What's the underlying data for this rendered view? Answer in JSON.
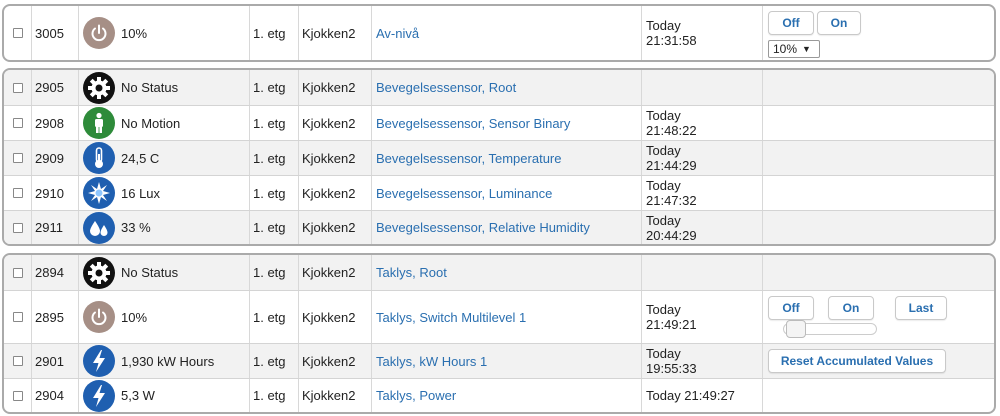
{
  "groups": [
    {
      "rows": [
        {
          "id": "3005",
          "icon": "power-icon",
          "icon_color": "#a68f86",
          "status": "10%",
          "floor": "1. etg",
          "room": "Kjokken2",
          "name": "Av-nivå",
          "time1": "Today",
          "time2": "21:31:58",
          "controls": {
            "off_label": "Off",
            "on_label": "On",
            "select_value": "10%"
          }
        }
      ]
    },
    {
      "rows": [
        {
          "id": "2905",
          "icon": "gear-icon",
          "icon_color": "#111111",
          "status": "No Status",
          "floor": "1. etg",
          "room": "Kjokken2",
          "name": "Bevegelsessensor, Root",
          "time1": "",
          "time2": ""
        },
        {
          "id": "2908",
          "icon": "person-icon",
          "icon_color": "#2e8b3a",
          "status": "No Motion",
          "floor": "1. etg",
          "room": "Kjokken2",
          "name": "Bevegelsessensor, Sensor Binary",
          "time1": "Today",
          "time2": "21:48:22"
        },
        {
          "id": "2909",
          "icon": "thermometer-icon",
          "icon_color": "#1f5fb0",
          "status": "24,5 C",
          "floor": "1. etg",
          "room": "Kjokken2",
          "name": "Bevegelsessensor, Temperature",
          "time1": "Today",
          "time2": "21:44:29"
        },
        {
          "id": "2910",
          "icon": "luminance-icon",
          "icon_color": "#1f5fb0",
          "status": "16 Lux",
          "floor": "1. etg",
          "room": "Kjokken2",
          "name": "Bevegelsessensor, Luminance",
          "time1": "Today",
          "time2": "21:47:32"
        },
        {
          "id": "2911",
          "icon": "humidity-icon",
          "icon_color": "#1f5fb0",
          "status": "33 %",
          "floor": "1. etg",
          "room": "Kjokken2",
          "name": "Bevegelsessensor, Relative Humidity",
          "time1": "Today",
          "time2": "20:44:29"
        }
      ]
    },
    {
      "rows": [
        {
          "id": "2894",
          "icon": "gear-icon",
          "icon_color": "#111111",
          "status": "No Status",
          "floor": "1. etg",
          "room": "Kjokken2",
          "name": "Taklys, Root",
          "time1": "",
          "time2": ""
        },
        {
          "id": "2895",
          "icon": "power-icon",
          "icon_color": "#a68f86",
          "status": "10%",
          "floor": "1. etg",
          "room": "Kjokken2",
          "name": "Taklys, Switch Multilevel 1",
          "time1": "Today",
          "time2": "21:49:21",
          "controls": {
            "off_label": "Off",
            "on_label": "On",
            "last_label": "Last",
            "slider_level": 0.1
          }
        },
        {
          "id": "2901",
          "icon": "energy-icon",
          "icon_color": "#1f5fb0",
          "status": "1,930 kW Hours",
          "floor": "1. etg",
          "room": "Kjokken2",
          "name": "Taklys, kW Hours 1",
          "time1": "Today",
          "time2": "19:55:33",
          "controls": {
            "reset_label": "Reset Accumulated Values"
          }
        },
        {
          "id": "2904",
          "icon": "energy-icon",
          "icon_color": "#1f5fb0",
          "status": "5,3 W",
          "floor": "1. etg",
          "room": "Kjokken2",
          "name": "Taklys, Power",
          "time1": "Today 21:49:27",
          "time2": ""
        }
      ]
    }
  ]
}
